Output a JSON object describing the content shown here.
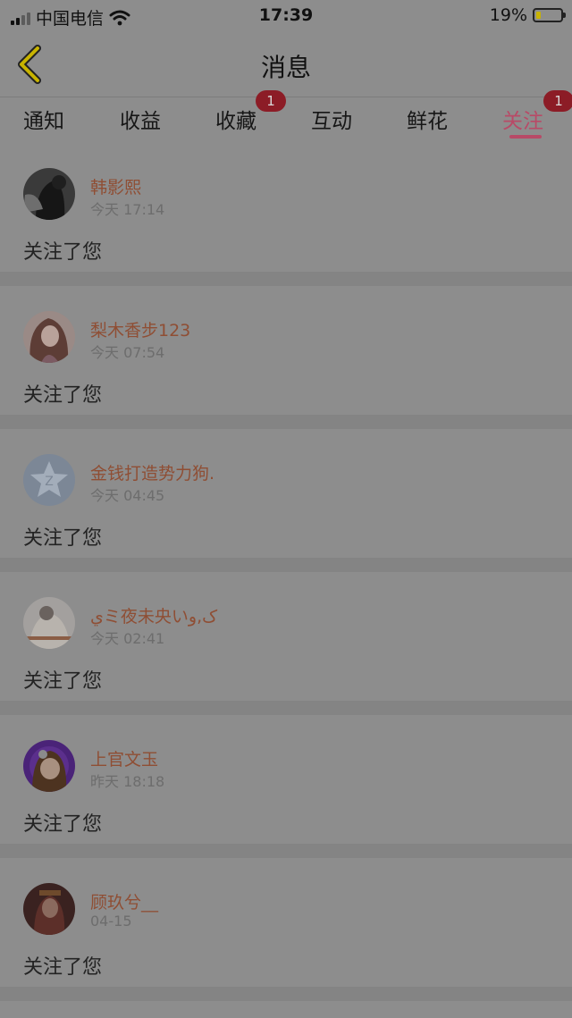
{
  "status_bar": {
    "carrier": "中国电信",
    "time": "17:39",
    "battery_percent": "19%",
    "battery_level": 0.19,
    "signal_bars": 2,
    "wifi_icon": "wifi-icon"
  },
  "nav": {
    "title": "消息",
    "back_icon": "chevron-left-icon",
    "accent_color": "#c8b300"
  },
  "tabs": [
    {
      "label": "通知",
      "badge": ""
    },
    {
      "label": "收益",
      "badge": ""
    },
    {
      "label": "收藏",
      "badge": "1"
    },
    {
      "label": "互动",
      "badge": ""
    },
    {
      "label": "鲜花",
      "badge": ""
    },
    {
      "label": "关注",
      "badge": "1",
      "active": true
    }
  ],
  "colors": {
    "active_tab": "#b84a67",
    "badge": "#8c1c26",
    "username": "#8f4e34"
  },
  "items": [
    {
      "name": "韩影熙",
      "time": "今天 17:14",
      "message": "关注了您",
      "avatar": "dark-photo-avatar"
    },
    {
      "name": "梨木香步123",
      "time": "今天 07:54",
      "message": "关注了您",
      "avatar": "anime-girl-avatar"
    },
    {
      "name": "金钱打造势力狗.",
      "time": "今天 04:45",
      "message": "关注了您",
      "avatar": "default-star-avatar"
    },
    {
      "name": "ﻱミ夜未央いﮎ,ﻭ",
      "time": "今天 02:41",
      "message": "关注了您",
      "avatar": "light-photo-avatar"
    },
    {
      "name": "上官文玉",
      "time": "昨天 18:18",
      "message": "关注了您",
      "avatar": "purple-anime-avatar"
    },
    {
      "name": "顾玖兮__",
      "time": "04-15",
      "message": "关注了您",
      "avatar": "costume-photo-avatar"
    }
  ]
}
